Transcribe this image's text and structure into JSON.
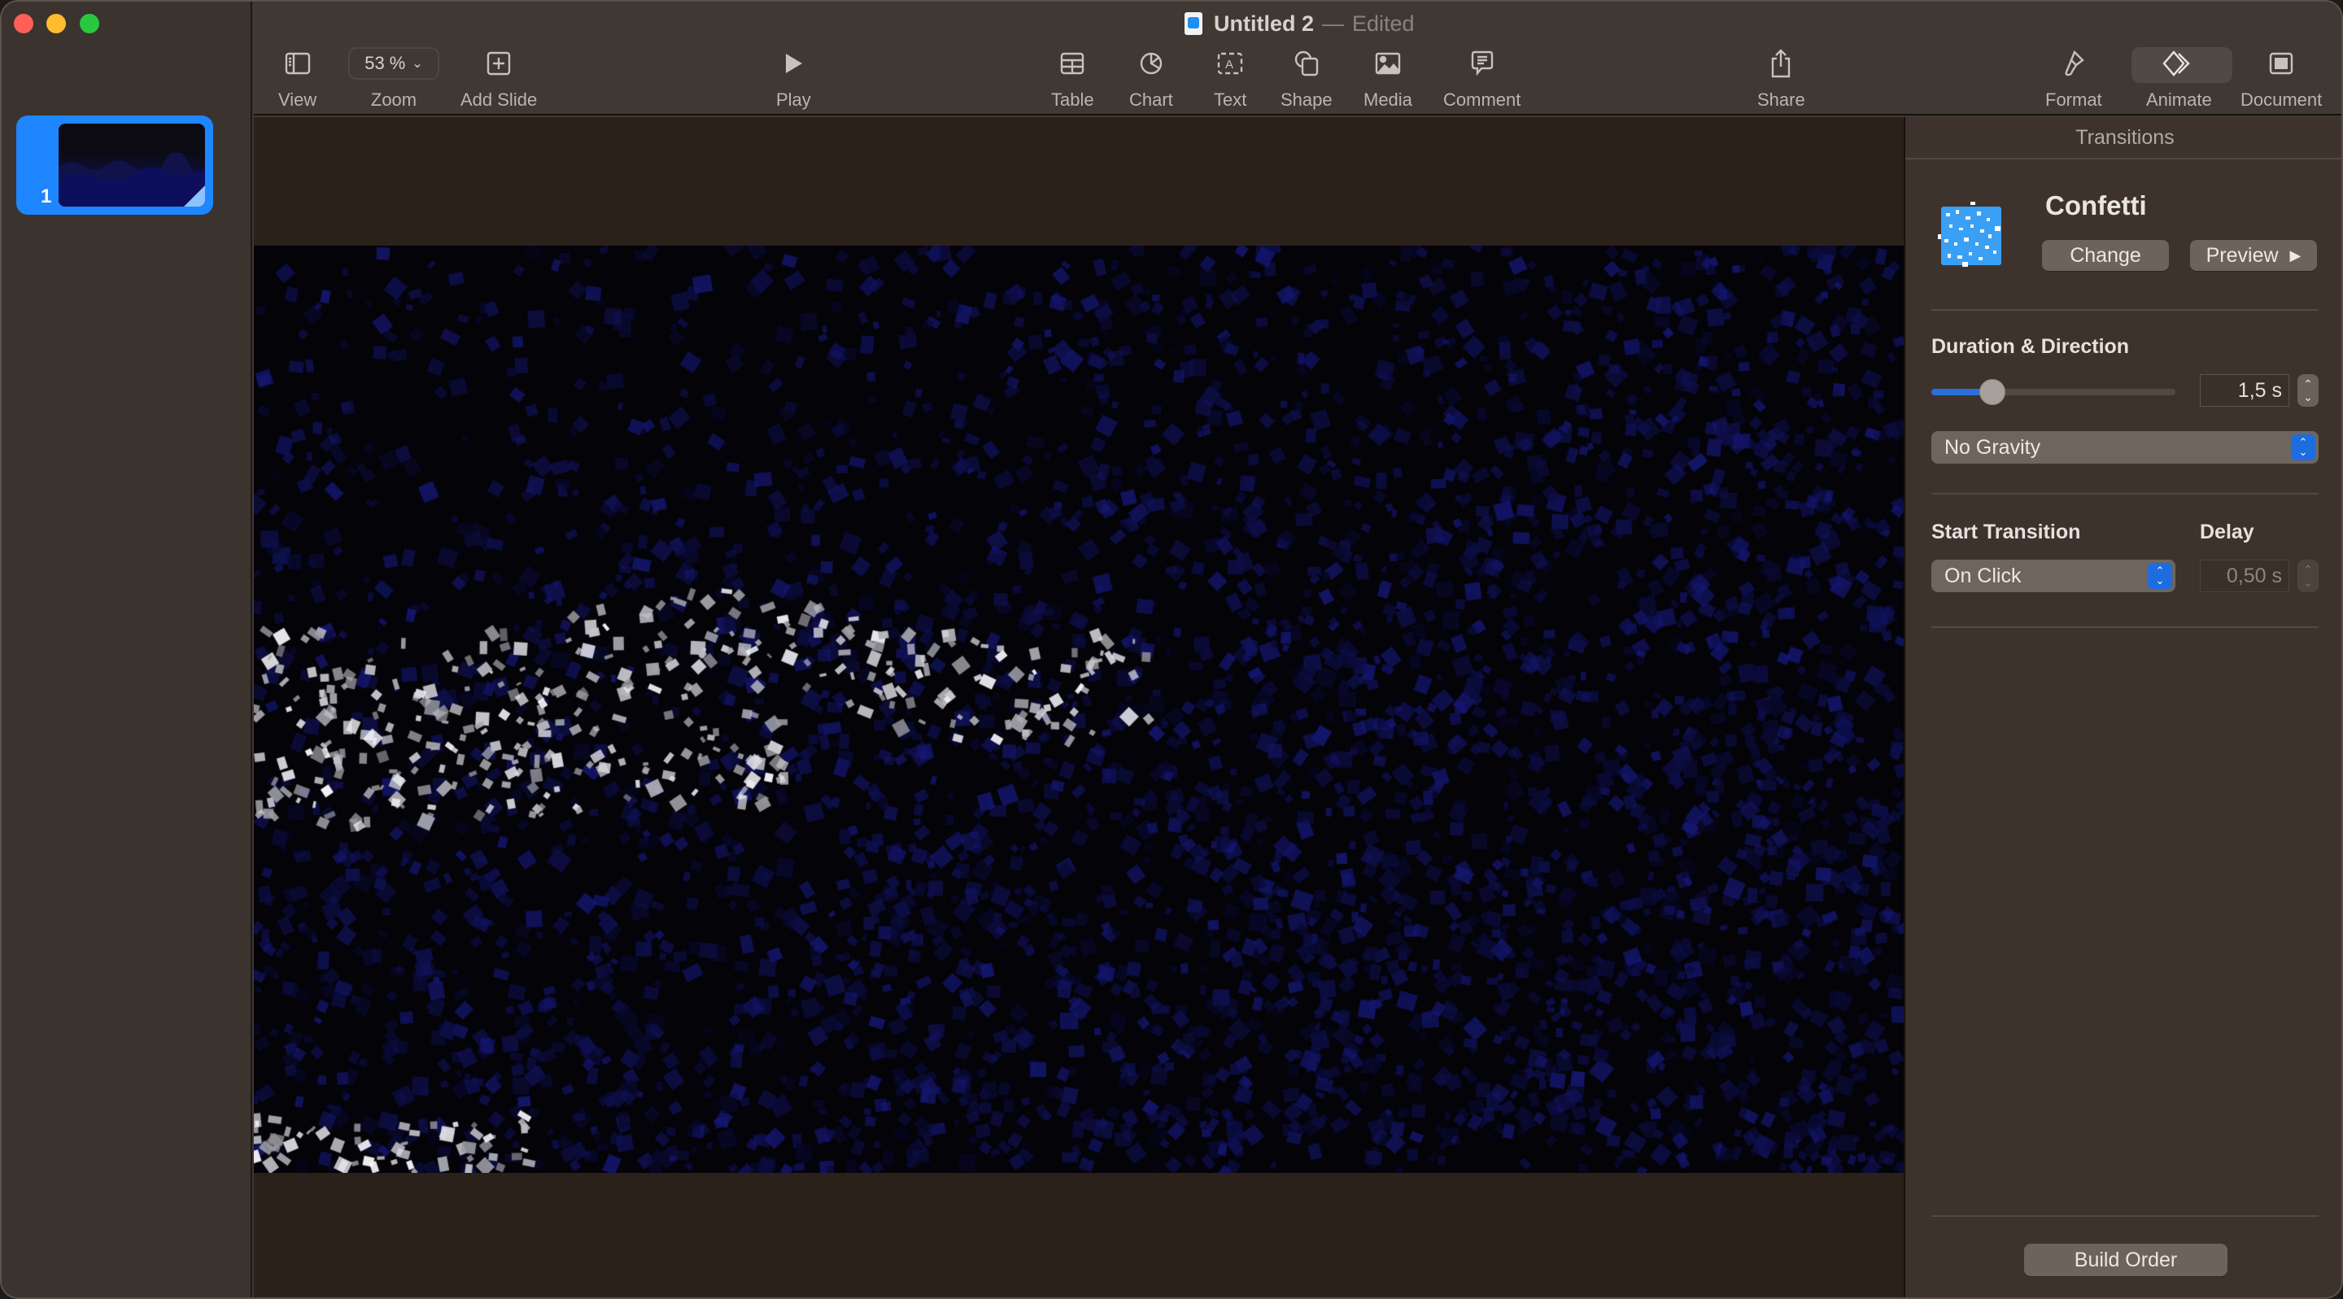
{
  "window": {
    "title": "Untitled 2",
    "title_separator": "—",
    "title_status": "Edited"
  },
  "toolbar": {
    "view_label": "View",
    "zoom_value": "53 %",
    "zoom_label": "Zoom",
    "add_slide_label": "Add Slide",
    "play_label": "Play",
    "table_label": "Table",
    "chart_label": "Chart",
    "text_label": "Text",
    "shape_label": "Shape",
    "media_label": "Media",
    "comment_label": "Comment",
    "share_label": "Share",
    "format_label": "Format",
    "animate_label": "Animate",
    "document_label": "Document",
    "active_tab": "Animate"
  },
  "navigator": {
    "slides": [
      {
        "number": "1",
        "selected": true
      }
    ]
  },
  "panel": {
    "header": "Transitions",
    "transition_name": "Confetti",
    "change_label": "Change",
    "preview_label": "Preview",
    "duration_section_label": "Duration & Direction",
    "duration_value": "1,5 s",
    "duration_slider_fraction": 0.25,
    "direction_value": "No Gravity",
    "start_transition_label": "Start Transition",
    "start_transition_value": "On Click",
    "delay_label": "Delay",
    "delay_value": "0,50 s",
    "build_order_label": "Build Order"
  },
  "colors": {
    "accent": "#1e86ff",
    "popup_arrow": "#1d6ce0",
    "slider_fill": "#2a6fdb",
    "slide_background": "#040308",
    "confetti_blue": "#1a1f7a",
    "confetti_white": "#d6d6da"
  }
}
